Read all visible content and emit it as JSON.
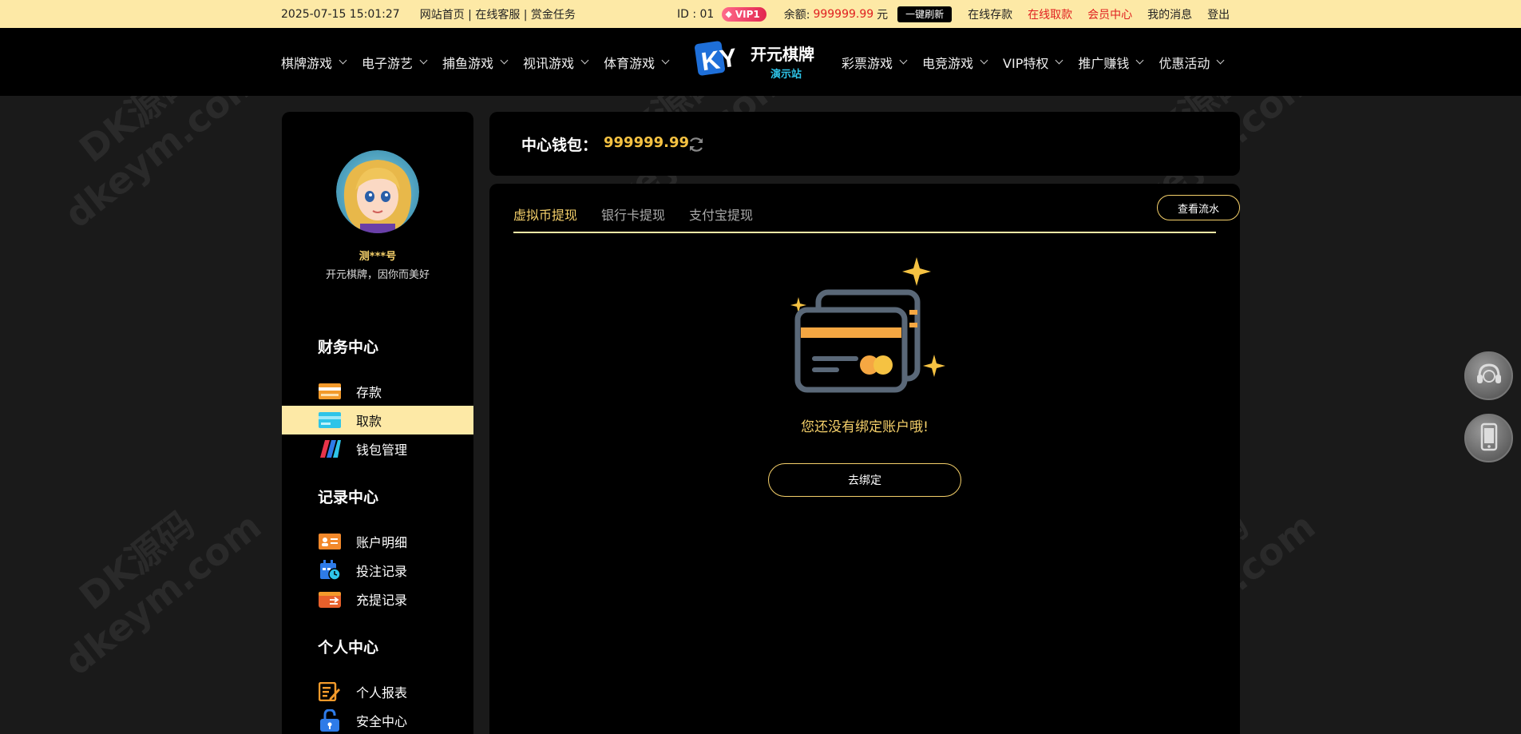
{
  "topbar": {
    "datetime": "2025-07-15 15:01:27",
    "links": "网站首页 | 在线客服 | 赏金任务",
    "id_text": "ID : 01",
    "vip_label": "VIP1",
    "balance_label": "余额:",
    "balance_value": "999999.99",
    "balance_unit": "元",
    "refresh_label": "一键刷新",
    "nav": [
      "在线存款",
      "在线取款",
      "会员中心",
      "我的消息",
      "登出"
    ]
  },
  "mainnav": {
    "left": [
      "棋牌游戏",
      "电子游艺",
      "捕鱼游戏",
      "视讯游戏",
      "体育游戏"
    ],
    "right": [
      "彩票游戏",
      "电竞游戏",
      "VIP特权",
      "推广赚钱",
      "优惠活动"
    ],
    "logo": {
      "letters": "KY",
      "name": "开元棋牌",
      "sub": "演示站"
    }
  },
  "sidebar": {
    "username": "测***号",
    "slogan": "开元棋牌，因你而美好",
    "sections": [
      {
        "title": "财务中心",
        "items": [
          "存款",
          "取款",
          "钱包管理"
        ]
      },
      {
        "title": "记录中心",
        "items": [
          "账户明细",
          "投注记录",
          "充提记录"
        ]
      },
      {
        "title": "个人中心",
        "items": [
          "个人报表",
          "安全中心"
        ]
      }
    ]
  },
  "wallet": {
    "label": "中心钱包：",
    "value": "999999.99"
  },
  "content": {
    "tabs": [
      "虚拟币提现",
      "银行卡提现",
      "支付宝提现"
    ],
    "flow_button": "查看流水",
    "empty_text": "您还没有绑定账户哦!",
    "bind_button": "去绑定"
  },
  "watermark": {
    "line1": "DK源码",
    "line2": "dkeym.com"
  },
  "colors": {
    "accent": "#f5d06a",
    "topbar_bg": "#fde9a6",
    "red": "#e02020",
    "panel_bg": "#000000",
    "page_bg": "#1a1a1a"
  }
}
